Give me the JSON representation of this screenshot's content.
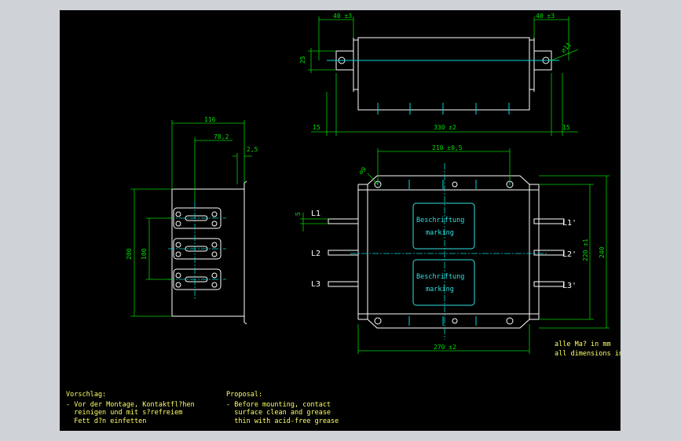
{
  "dimensions": {
    "top_left_40": "40 ±3",
    "top_right_40": "40 ±3",
    "top_25": "25",
    "top_phi11": "⌀11",
    "top_15_left": "15",
    "top_330": "330 ±2",
    "top_15_right": "15",
    "side_116": "116",
    "side_78": "78,2",
    "side_25": "2,5",
    "side_200": "200",
    "side_100": "100",
    "front_210": "210 ±0,5",
    "front_phi9": "⌀9",
    "front_5": "5",
    "front_220": "220 ±1",
    "front_240": "240",
    "front_270": "270 ±2"
  },
  "terminals": {
    "l1": "L1",
    "l2": "L2",
    "l3": "L3",
    "l1p": "L1'",
    "l2p": "L2'",
    "l3p": "L3'"
  },
  "marking_boxes": {
    "upper": {
      "line1": "Beschriftung",
      "line2": "marking"
    },
    "lower": {
      "line1": "Beschriftung",
      "line2": "marking"
    }
  },
  "units_note": {
    "line1": "alle Ma? in mm",
    "line2": "all dimensions in mm"
  },
  "notes": {
    "de_title": "Vorschlag:",
    "de_line1": "- Vor der Montage, Kontaktfl?hen",
    "de_line2": "  reinigen und mit s?refreiem",
    "de_line3": "  Fett d?n einfetten",
    "en_title": "Proposal:",
    "en_line1": "- Before mounting, contact",
    "en_line2": "  surface clean and grease",
    "en_line3": "  thin with acid-free grease"
  },
  "colors": {
    "background": "#000000",
    "outline": "#ffffff",
    "dimension": "#00e000",
    "centerline": "#00d8d8",
    "notes": "#ffff66"
  }
}
